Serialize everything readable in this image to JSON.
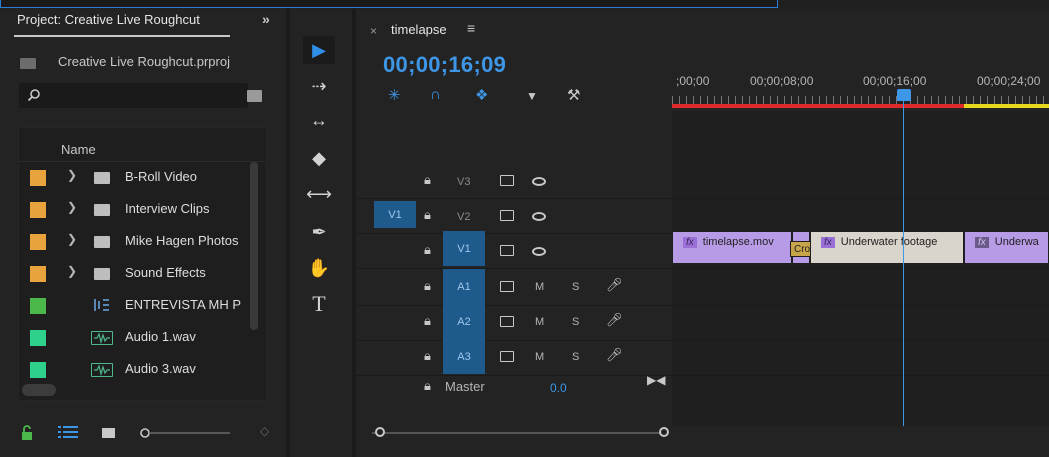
{
  "project": {
    "tab_label": "Project: Creative Live Roughcut",
    "file_name": "Creative Live Roughcut.prproj",
    "search_placeholder": "",
    "column_name": "Name",
    "items": [
      {
        "label": "B-Roll Video",
        "type": "bin",
        "color": "#e8a33c"
      },
      {
        "label": "Interview Clips",
        "type": "bin",
        "color": "#e8a33c"
      },
      {
        "label": "Mike Hagen Photos",
        "type": "bin",
        "color": "#e8a33c"
      },
      {
        "label": "Sound Effects",
        "type": "bin",
        "color": "#e8a33c"
      },
      {
        "label": "ENTREVISTA MH P",
        "type": "sequence",
        "color": "#4cb84c"
      },
      {
        "label": "Audio 1.wav",
        "type": "audio",
        "color": "#2fcf8c"
      },
      {
        "label": "Audio 3.wav",
        "type": "audio",
        "color": "#2fcf8c"
      }
    ]
  },
  "timeline": {
    "tab_label": "timelapse",
    "timecode": "00;00;16;09",
    "ruler_labels": [
      ";00;00",
      "00;00;08;00",
      "00;00;16;00",
      "00;00;24;00"
    ],
    "tracks": {
      "video": [
        {
          "name": "V3"
        },
        {
          "name": "V2",
          "source_patch": "V1"
        },
        {
          "name": "V1"
        }
      ],
      "audio": [
        {
          "name": "A1",
          "mute": "M",
          "solo": "S"
        },
        {
          "name": "A2",
          "mute": "M",
          "solo": "S"
        },
        {
          "name": "A3",
          "mute": "M",
          "solo": "S"
        }
      ],
      "master_label": "Master",
      "master_value": "0.0"
    },
    "clips": [
      {
        "label": "timelapse.mov",
        "fx": "fx",
        "color": "#b89be6"
      },
      {
        "label": "Cros",
        "color": "#c9a54a"
      },
      {
        "label": "Underwater footage",
        "fx": "fx",
        "color": "#d9d4cc"
      },
      {
        "label": "Underwa",
        "fx": "fx",
        "color": "#b89be6"
      }
    ],
    "accent": "#3e96e6"
  }
}
